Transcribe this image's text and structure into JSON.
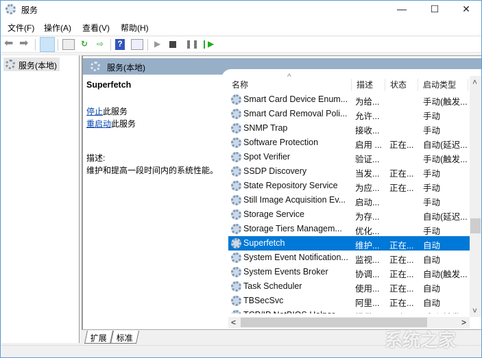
{
  "window": {
    "title": "服务",
    "minimize": "—",
    "maximize": "☐",
    "close": "✕"
  },
  "menu": [
    "文件(F)",
    "操作(A)",
    "查看(V)",
    "帮助(H)"
  ],
  "tree": {
    "root": "服务(本地)"
  },
  "panel": {
    "title": "服务(本地)"
  },
  "detail": {
    "service_name": "Superfetch",
    "stop_link": "停止",
    "stop_suffix": "此服务",
    "restart_link": "重启动",
    "restart_suffix": "此服务",
    "desc_label": "描述:",
    "desc_text": "维护和提高一段时间内的系统性能。"
  },
  "columns": {
    "name": "名称",
    "desc": "描述",
    "status": "状态",
    "startup": "启动类型",
    "sort_arrow": "^"
  },
  "rows": [
    {
      "name": "Smart Card Device Enum...",
      "desc": "为给...",
      "status": "",
      "startup": "手动(触发..."
    },
    {
      "name": "Smart Card Removal Poli...",
      "desc": "允许...",
      "status": "",
      "startup": "手动"
    },
    {
      "name": "SNMP Trap",
      "desc": "接收...",
      "status": "",
      "startup": "手动"
    },
    {
      "name": "Software Protection",
      "desc": "启用 ...",
      "status": "正在...",
      "startup": "自动(延迟..."
    },
    {
      "name": "Spot Verifier",
      "desc": "验证...",
      "status": "",
      "startup": "手动(触发..."
    },
    {
      "name": "SSDP Discovery",
      "desc": "当发...",
      "status": "正在...",
      "startup": "手动"
    },
    {
      "name": "State Repository Service",
      "desc": "为应...",
      "status": "正在...",
      "startup": "手动"
    },
    {
      "name": "Still Image Acquisition Ev...",
      "desc": "启动...",
      "status": "",
      "startup": "手动"
    },
    {
      "name": "Storage Service",
      "desc": "为存...",
      "status": "",
      "startup": "自动(延迟..."
    },
    {
      "name": "Storage Tiers Managem...",
      "desc": "优化...",
      "status": "",
      "startup": "手动"
    },
    {
      "name": "Superfetch",
      "desc": "维护...",
      "status": "正在...",
      "startup": "自动",
      "selected": true
    },
    {
      "name": "System Event Notification...",
      "desc": "监视...",
      "status": "正在...",
      "startup": "自动"
    },
    {
      "name": "System Events Broker",
      "desc": "协调...",
      "status": "正在...",
      "startup": "自动(触发..."
    },
    {
      "name": "Task Scheduler",
      "desc": "使用...",
      "status": "正在...",
      "startup": "自动"
    },
    {
      "name": "TBSecSvc",
      "desc": "阿里...",
      "status": "正在...",
      "startup": "自动"
    },
    {
      "name": "TCP/IP NetBIOS Helper",
      "desc": "提供...",
      "status": "正在...",
      "startup": "手动(触发..."
    }
  ],
  "scroll": {
    "up": "˄",
    "down": "˅",
    "left": "<",
    "right": ">"
  },
  "tabs": [
    "扩展",
    "标准"
  ],
  "watermark": "系统之家",
  "colors": {
    "selection": "#0078d7",
    "band": "#98afc8",
    "link": "#0645ad"
  }
}
